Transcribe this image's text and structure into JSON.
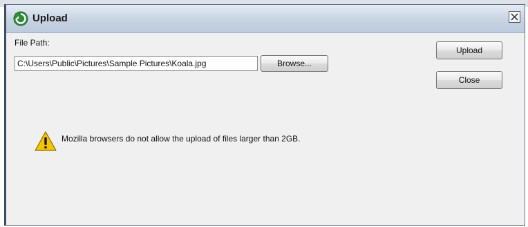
{
  "dialog": {
    "title": "Upload",
    "file_path_label": "File Path:",
    "file_path_value": "C:\\Users\\Public\\Pictures\\Sample Pictures\\Koala.jpg",
    "browse_label": "Browse...",
    "upload_label": "Upload",
    "close_label": "Close",
    "warning_message": "Mozilla browsers do not allow the upload of files larger than 2GB."
  },
  "icons": {
    "title_icon": "upload-logo-icon",
    "close": "close-icon",
    "warning": "warning-icon"
  },
  "colors": {
    "title_icon_green": "#2e8b3a",
    "warning_yellow": "#f5c400"
  }
}
